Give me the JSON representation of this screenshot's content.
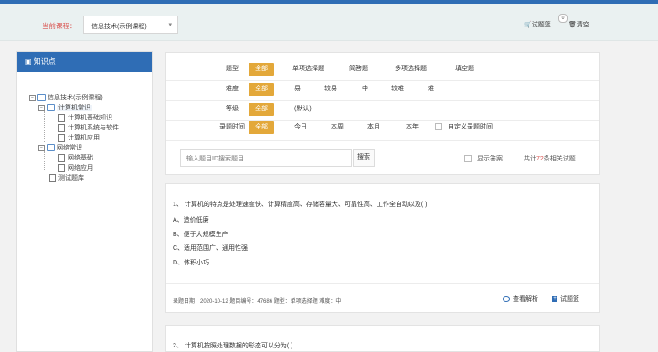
{
  "header": {
    "current_course_label": "当前课程：",
    "course_select_value": "信息技术(示例课程)",
    "cart_label": "试题篮",
    "cart_count": "0",
    "clear_label": "清空"
  },
  "sidebar": {
    "title": "知识点",
    "tree": [
      {
        "label": "信息技术(示例课程)",
        "level": 0
      },
      {
        "label": "计算机常识",
        "level": 1
      },
      {
        "label": "计算机基础知识",
        "level": 2
      },
      {
        "label": "计算机系统与软件",
        "level": 2
      },
      {
        "label": "计算机应用",
        "level": 2
      },
      {
        "label": "网络常识",
        "level": 1
      },
      {
        "label": "网络基础",
        "level": 2
      },
      {
        "label": "网络应用",
        "level": 2
      },
      {
        "label": "测试题库",
        "level": 1
      }
    ]
  },
  "filters": {
    "type": {
      "label": "题型",
      "options": [
        "全部",
        "单项选择题",
        "简答题",
        "多项选择题",
        "填空题"
      ]
    },
    "difficulty": {
      "label": "难度",
      "options": [
        "全部",
        "易",
        "较易",
        "中",
        "较难",
        "难"
      ]
    },
    "level": {
      "label": "等级",
      "options": [
        "全部",
        "(默认)"
      ]
    },
    "time": {
      "label": "录题时间",
      "options": [
        "全部",
        "今日",
        "本周",
        "本月",
        "本年"
      ],
      "custom": "自定义录题时间"
    }
  },
  "search": {
    "placeholder": "输入题目ID搜索题目",
    "button": "搜索",
    "show_answer": "显示答案",
    "count_prefix": "共计",
    "count": "72",
    "count_suffix": "条相关试题"
  },
  "questions": [
    {
      "stem": "1、 计算机的特点是处理速度快、计算精度高、存储容量大、可靠性高、工作全自动以及(    )",
      "options": [
        "A、造价低廉",
        "B、便于大规模生产",
        "C、适用范围广、通用性强",
        "D、体积小巧"
      ],
      "meta": "录题日期：2020-10-12   题目编号：47686   题型：单项选择题   难度：中",
      "view_label": "查看解析",
      "add_label": "试题篮"
    },
    {
      "stem": "2、 计算机按照处理数据的形态可以分为(    )"
    }
  ],
  "colors": {
    "brand": "#2f6db5",
    "active": "#e3a83a",
    "accent_red": "#d9534f"
  }
}
